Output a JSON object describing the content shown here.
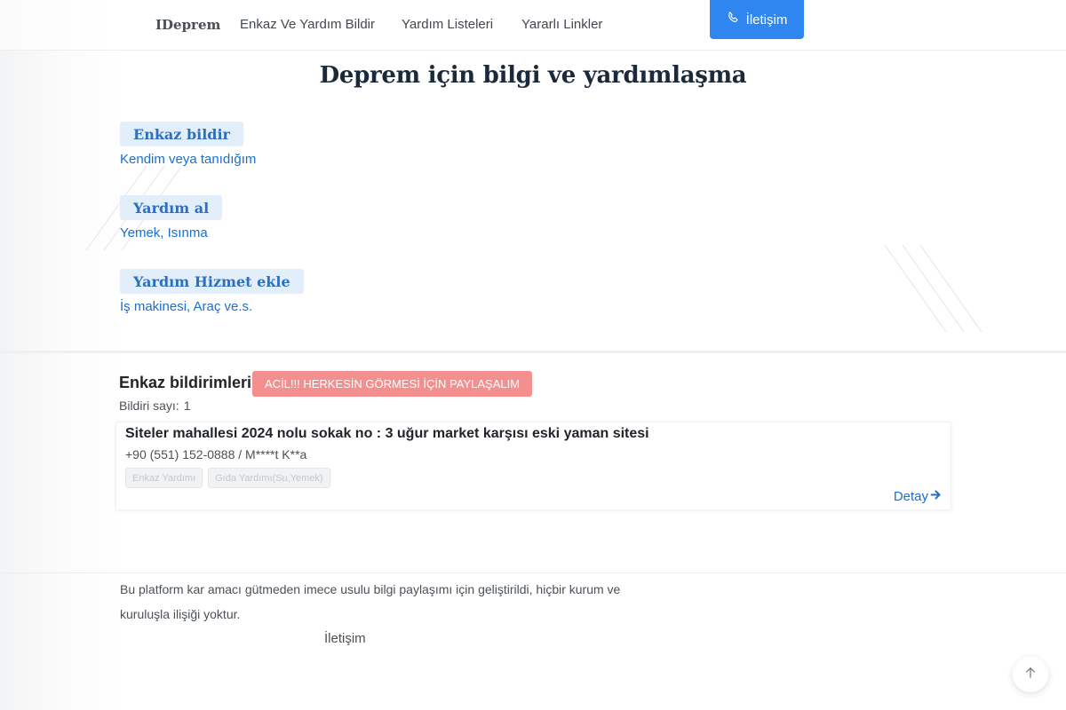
{
  "nav": {
    "brand": "IDeprem",
    "links": [
      "Enkaz Ve Yardım Bildir",
      "Yardım Listeleri",
      "Yararlı Linkler"
    ],
    "contact_button": "İletişim",
    "contact_icon": "phone-icon"
  },
  "hero": {
    "title": "Deprem için bilgi ve yardımlaşma",
    "actions": [
      {
        "label": "Enkaz bildir",
        "sub": "Kendim veya tanıdığım"
      },
      {
        "label": "Yardım al",
        "sub": "Yemek, Isınma"
      },
      {
        "label": "Yardım Hizmet ekle",
        "sub": "İş makinesi, Araç ve.s."
      }
    ]
  },
  "reports": {
    "title": "Enkaz bildirimleri -",
    "urgent_label": "ACİL!!! HERKESİN GÖRMESİ İÇİN PAYLAŞALIM",
    "count_label": "Bildiri sayı:",
    "count_value": "1",
    "items": [
      {
        "title": "Siteler mahallesi 2024 nolu sokak no : 3 uğur market karşısı eski yaman sitesi",
        "contact": "+90 (551) 152-0888 / M****t K**a",
        "tags": [
          "Enkaz Yardımı",
          "Gıda Yardımı(Su,Yemek)"
        ],
        "detail_label": "Detay",
        "detail_icon": "arrow-right-icon"
      }
    ]
  },
  "footer": {
    "text": "Bu platform kar amacı gütmeden imece usulu bilgi paylaşımı için geliştirildi, hiçbir kurum ve kuruluşla ilişiği yoktur.",
    "contact_link": "İletişim"
  },
  "scroll_top_icon": "arrow-up-icon",
  "colors": {
    "accent": "#2f86f0",
    "link": "#1a6fcf",
    "badge_bg": "#e3eefb",
    "urgent": "#f48f8f"
  }
}
